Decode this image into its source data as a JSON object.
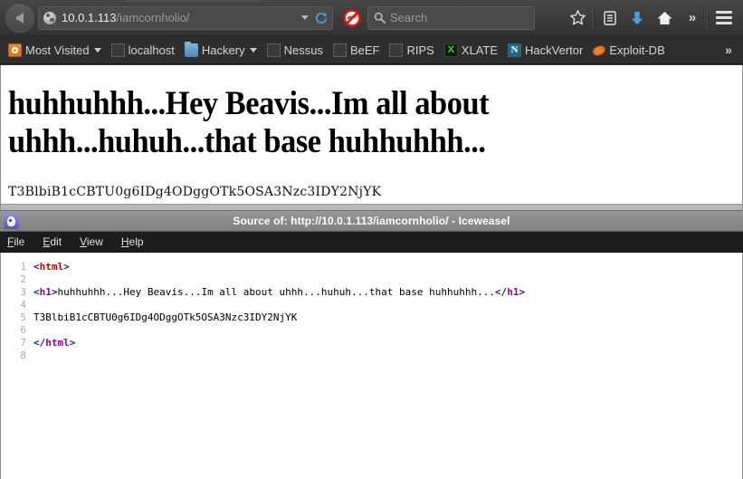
{
  "browser": {
    "back_button": "Back",
    "url": {
      "host": "10.0.1.113",
      "path": "/iamcornholio/",
      "full": "10.0.1.113/iamcornholio/"
    },
    "search_placeholder": "Search",
    "icons": {
      "globe": "globe-icon",
      "url_dropdown": "chevron-down-icon",
      "reload": "reload-icon",
      "noscript": "noscript-icon",
      "search": "search-icon",
      "bookmark_star": "star-icon",
      "reader": "reader-list-icon",
      "downloads": "download-arrow-icon",
      "home": "home-icon",
      "overflow": "chevron-double-right-icon",
      "menu": "hamburger-menu-icon"
    }
  },
  "bookmarks": {
    "items": [
      {
        "label": "Most Visited",
        "icon": "most-visited-icon",
        "caret": true
      },
      {
        "label": "localhost",
        "icon": "blank-favicon",
        "caret": false
      },
      {
        "label": "Hackery",
        "icon": "folder-icon",
        "caret": true
      },
      {
        "label": "Nessus",
        "icon": "blank-favicon",
        "caret": false
      },
      {
        "label": "BeEF",
        "icon": "blank-favicon",
        "caret": false
      },
      {
        "label": "RIPS",
        "icon": "blank-favicon",
        "caret": false
      },
      {
        "label": "XLATE",
        "icon": "xlate-favicon",
        "caret": false
      },
      {
        "label": "HackVertor",
        "icon": "hackvertor-favicon",
        "caret": false
      },
      {
        "label": "Exploit-DB",
        "icon": "exploit-db-favicon",
        "caret": false
      }
    ],
    "overflow": "»"
  },
  "page": {
    "heading": "huhhuhhh...Hey Beavis...Im all about uhhh...huhuh...that base huhhuhhh...",
    "paragraph": "T3BlbiB1cCBTU0g6IDg4ODggOTk5OSA3Nzc3IDY2NjYK"
  },
  "source_window": {
    "title": "Source of: http://10.0.1.113/iamcornholio/ - Iceweasel",
    "icon": "iceweasel-icon",
    "menu": [
      {
        "pre": "",
        "accel": "F",
        "post": "ile"
      },
      {
        "pre": "",
        "accel": "E",
        "post": "dit"
      },
      {
        "pre": "",
        "accel": "V",
        "post": "iew"
      },
      {
        "pre": "",
        "accel": "H",
        "post": "elp"
      }
    ],
    "code_lines": [
      {
        "n": "1",
        "parts": [
          {
            "t": "<",
            "c": "tag-br"
          },
          {
            "t": "html",
            "c": "tag-html"
          },
          {
            "t": ">",
            "c": "tag-br"
          }
        ]
      },
      {
        "n": "2",
        "parts": []
      },
      {
        "n": "3",
        "parts": [
          {
            "t": "<",
            "c": "tag-br"
          },
          {
            "t": "h1",
            "c": "tag-h1"
          },
          {
            "t": ">",
            "c": "tag-br"
          },
          {
            "t": "huhhuhhh...Hey Beavis...Im all about uhhh...huhuh...that base huhhuhhh...",
            "c": "code-text"
          },
          {
            "t": "</",
            "c": "tag-slash"
          },
          {
            "t": "h1",
            "c": "tag-h1"
          },
          {
            "t": ">",
            "c": "tag-br"
          }
        ]
      },
      {
        "n": "4",
        "parts": []
      },
      {
        "n": "5",
        "parts": [
          {
            "t": "T3BlbiB1cCBTU0g6IDg4ODggOTk5OSA3Nzc3IDY2NjYK",
            "c": "code-text"
          }
        ]
      },
      {
        "n": "6",
        "parts": []
      },
      {
        "n": "7",
        "parts": [
          {
            "t": "</",
            "c": "tag-slash"
          },
          {
            "t": "html",
            "c": "tag-h1"
          },
          {
            "t": ">",
            "c": "tag-br"
          }
        ]
      },
      {
        "n": "8",
        "parts": []
      }
    ]
  },
  "colors": {
    "chrome": "#393939",
    "bookmarks_bar": "#2e2e2e",
    "titlebar": "#8b8b8b",
    "menubar": "#1c1c1c",
    "tag_red": "#cc0000",
    "tag_purple": "#9400a3",
    "bracket_blue": "#1e1e8c",
    "download_blue": "#4a9fe0",
    "gutter_gray": "#a9a9a9"
  }
}
